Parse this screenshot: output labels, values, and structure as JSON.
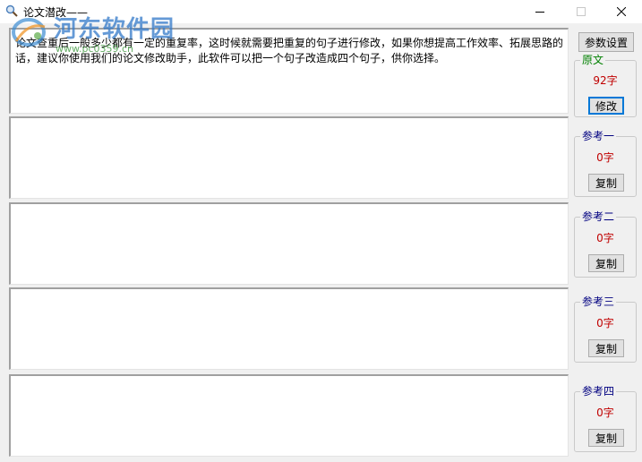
{
  "window": {
    "title": "论文潜改——",
    "icon": "magnifier-icon"
  },
  "watermark": {
    "site_name": "河东软件园",
    "url": "www.pc0359.cn"
  },
  "editors": {
    "original_text": "论文查重后一般多少都有一定的重复率，这时候就需要把重复的句子进行修改，如果你想提高工作效率、拓展思路的话，建议你使用我们的论文修改助手，此软件可以把一个句子改造成四个句子，供你选择。",
    "ref1_text": "",
    "ref2_text": "",
    "ref3_text": "",
    "ref4_text": ""
  },
  "sidebar": {
    "settings_label": "参数设置",
    "original": {
      "legend": "原文",
      "count": "92字",
      "button": "修改"
    },
    "ref1": {
      "legend": "参考一",
      "count": "0字",
      "button": "复制"
    },
    "ref2": {
      "legend": "参考二",
      "count": "0字",
      "button": "复制"
    },
    "ref3": {
      "legend": "参考三",
      "count": "0字",
      "button": "复制"
    },
    "ref4": {
      "legend": "参考四",
      "count": "0字",
      "button": "复制"
    }
  },
  "colors": {
    "legend_original": "#008000",
    "legend_refs": "#000080",
    "count": "#c00000",
    "focus": "#0078d7"
  }
}
